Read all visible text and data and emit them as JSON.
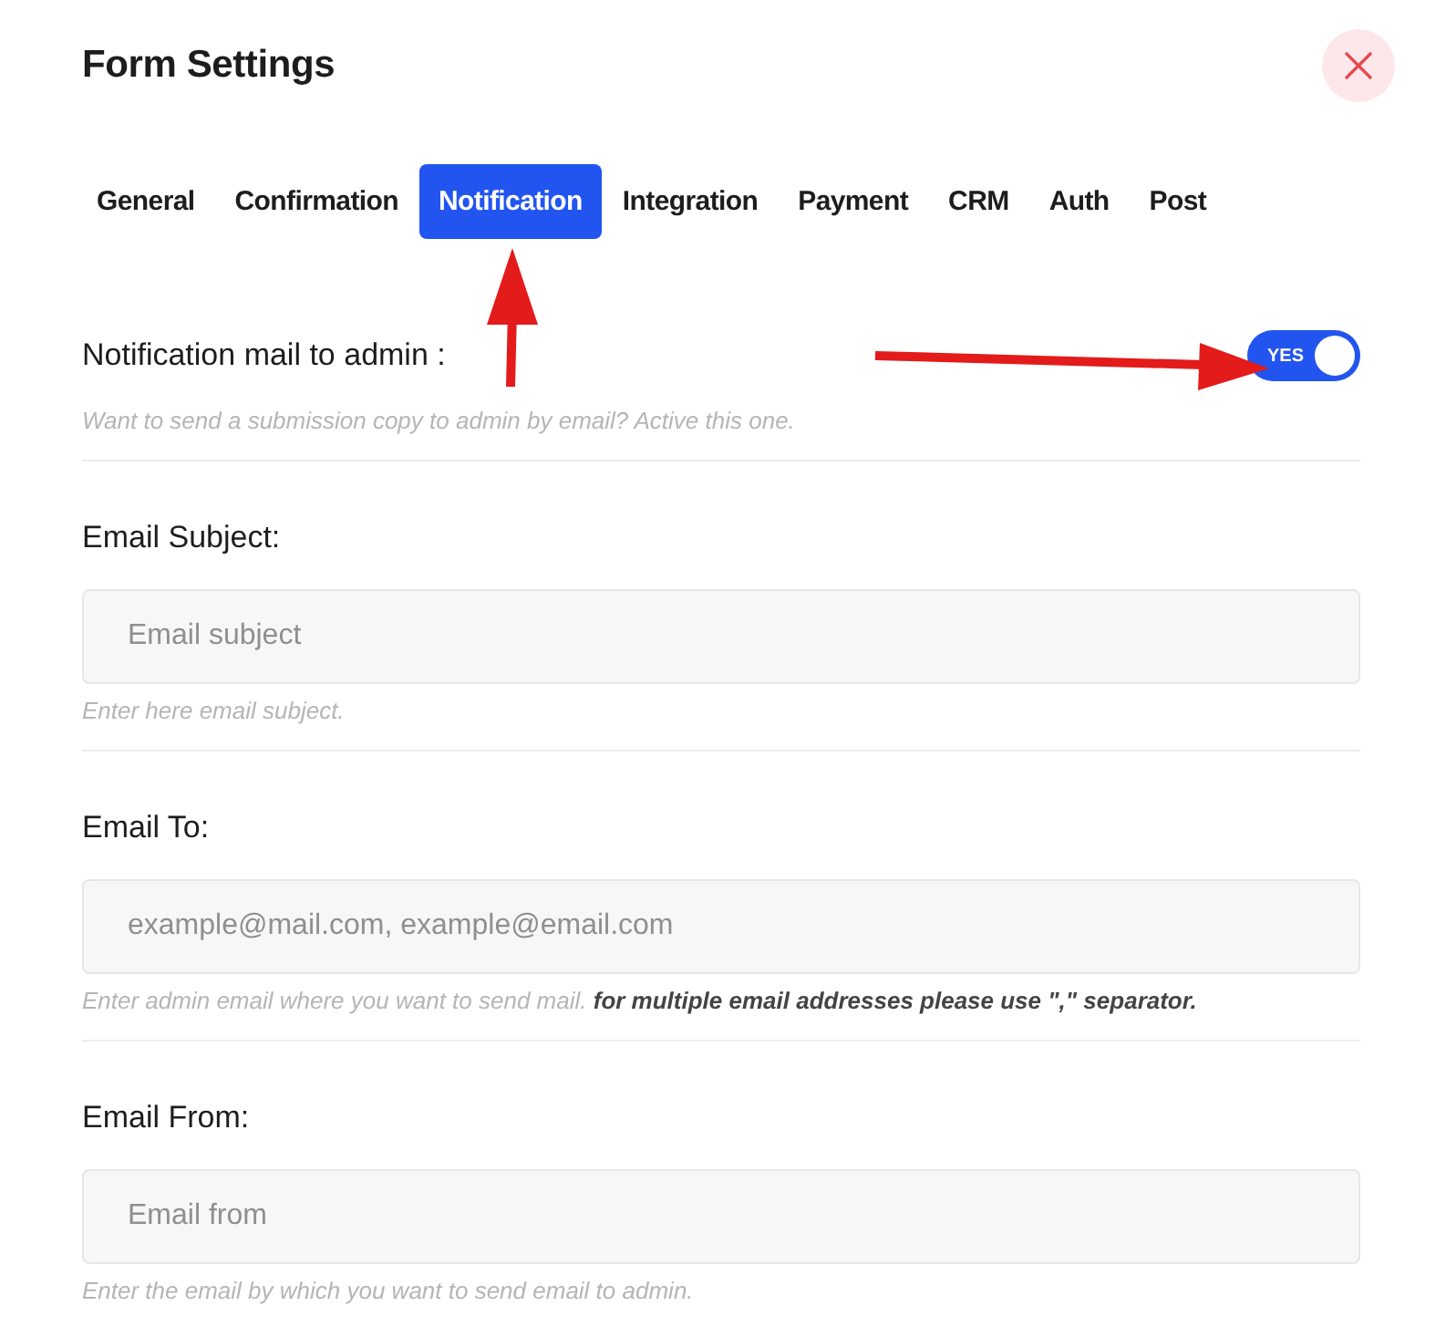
{
  "title": "Form Settings",
  "tabs": [
    {
      "label": "General",
      "selected": false
    },
    {
      "label": "Confirmation",
      "selected": false
    },
    {
      "label": "Notification",
      "selected": true
    },
    {
      "label": "Integration",
      "selected": false
    },
    {
      "label": "Payment",
      "selected": false
    },
    {
      "label": "CRM",
      "selected": false
    },
    {
      "label": "Auth",
      "selected": false
    },
    {
      "label": "Post",
      "selected": false
    }
  ],
  "admin_mail": {
    "label": "Notification mail to admin :",
    "toggle": {
      "on": true,
      "label": "YES"
    },
    "hint": "Want to send a submission copy to admin by email? Active this one."
  },
  "fields": [
    {
      "label": "Email Subject:",
      "placeholder": "Email subject",
      "hint": "Enter here email subject."
    },
    {
      "label": "Email To:",
      "placeholder": "example@mail.com, example@email.com",
      "hint": "Enter admin email where you want to send mail. **for multiple email addresses please use \",\" separator.**"
    },
    {
      "label": "Email From:",
      "placeholder": "Email from",
      "hint": "Enter the email by which you want to send email to admin."
    }
  ]
}
